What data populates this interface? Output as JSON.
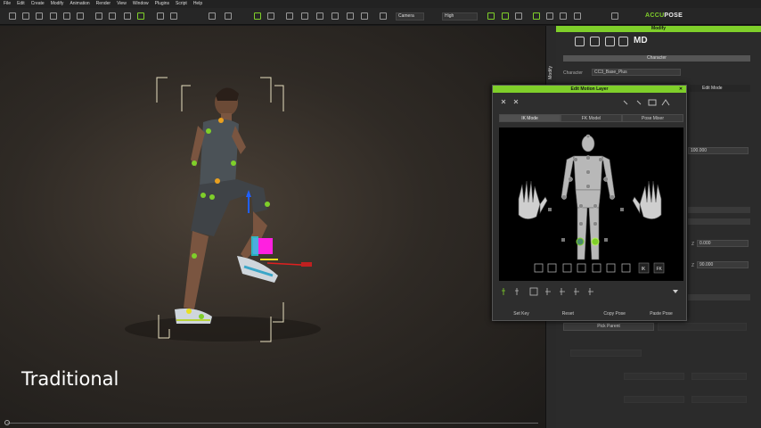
{
  "menu": [
    "File",
    "Edit",
    "Create",
    "Modify",
    "Animation",
    "Render",
    "View",
    "Window",
    "Plugins",
    "Script",
    "Help"
  ],
  "toolbar": {
    "camera_select": "Camera",
    "quality_select": "High"
  },
  "logo": {
    "prefix": "ACCU",
    "suffix": "POSE"
  },
  "viewport": {
    "overlay_label": "Traditional"
  },
  "sidebar": {
    "tab_label": "Modify"
  },
  "modify_panel": {
    "title": "Modify",
    "md_logo": "MD",
    "section_character": "Character",
    "character_label": "Character",
    "character_value": "CC3_Base_Plus",
    "value_top": "100.000",
    "z_label_1": "Z",
    "z_value_1": "0.000",
    "z_label_2": "Z",
    "z_value_2": "90.000",
    "pick_parent": "Pick Parent"
  },
  "edit_mode": {
    "label": "Edit Mode"
  },
  "edit_motion_layer": {
    "title": "Edit Motion Layer",
    "tabs": [
      "IK Mode",
      "FK Model",
      "Pose Mixer"
    ],
    "ik_label": "IK",
    "fk_label": "FK",
    "actions": [
      "Set Key",
      "Reset",
      "Copy Pose",
      "Paste Pose"
    ]
  }
}
